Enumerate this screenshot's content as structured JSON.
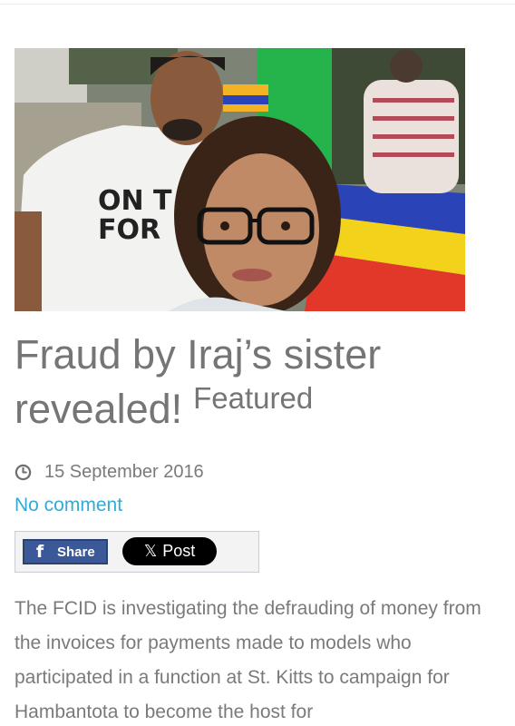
{
  "article": {
    "image_alt": "Selfie of a man and a woman at an outdoor event",
    "title": "Fraud by Iraj’s sister revealed!",
    "featured_label": "Featured",
    "date": "15 September 2016",
    "comment_link": "No comment",
    "share": {
      "facebook_label": "Share",
      "x_label": "Post"
    },
    "body": "The FCID is investigating the defrauding of money from the invoices for payments made to models who participated in a function at St. Kitts to campaign for Hambantota to become the host for"
  },
  "icons": {
    "date": "clock-icon",
    "facebook": "facebook-icon",
    "x": "x-logo-icon"
  },
  "colors": {
    "link": "#35a9d6",
    "facebook": "#3b5998",
    "x": "#000000",
    "text": "#757575"
  }
}
